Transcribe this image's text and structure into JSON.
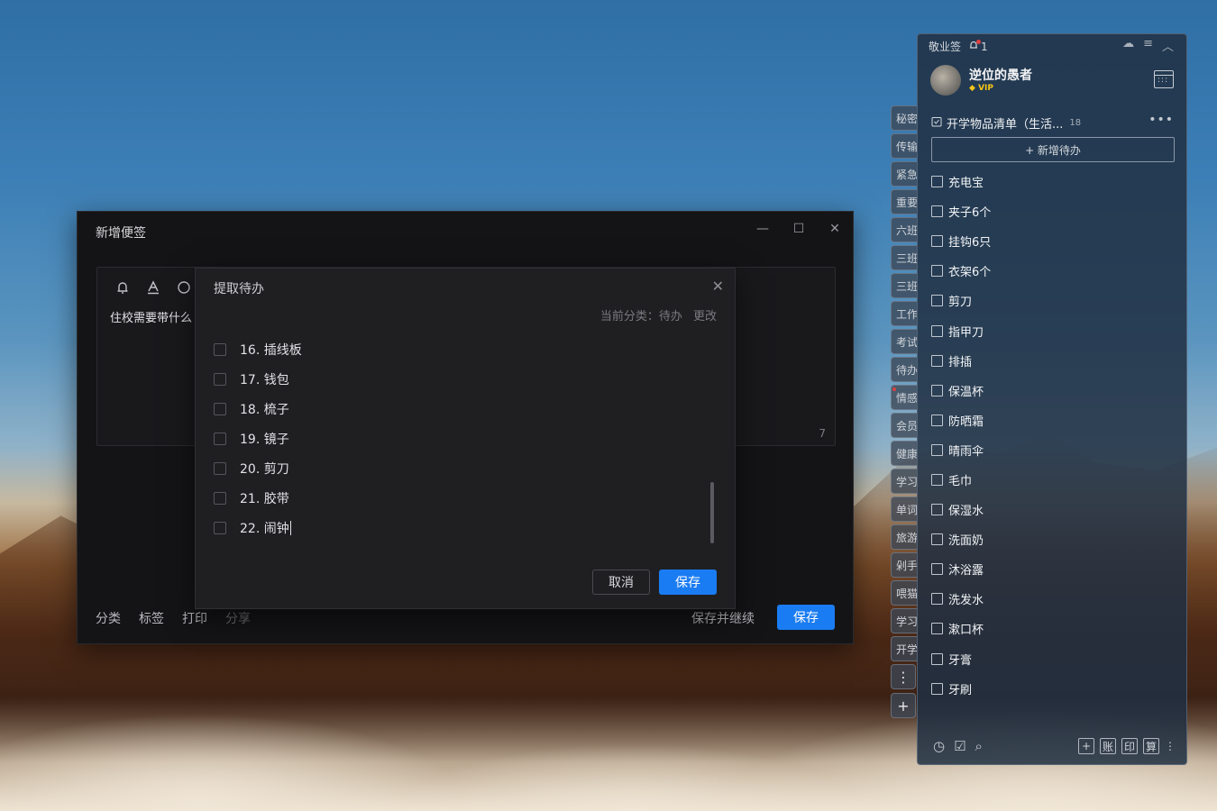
{
  "note_window": {
    "title": "新增便签",
    "controls": {
      "minimize": "—",
      "maximize": "☐",
      "close": "✕"
    },
    "toolbar": {
      "bell": "🔔",
      "font": "A",
      "circle": "◯"
    },
    "editor_text": "住校需要带什么",
    "char_count": "7",
    "bottom_links": [
      "分类",
      "标签",
      "打印",
      "分享"
    ],
    "save_continue": "保存并继续",
    "save": "保存"
  },
  "dialog": {
    "title": "提取待办",
    "close": "✕",
    "category_label": "当前分类：待办",
    "change": "更改",
    "items": [
      "16. 插线板",
      "17. 钱包",
      "18. 梳子",
      "19. 镜子",
      "20. 剪刀",
      "21. 胶带",
      "22. 闹钟"
    ],
    "cancel": "取消",
    "save": "保存"
  },
  "side_tabs": [
    "秘密",
    "传输",
    "紧急",
    "重要",
    "六班",
    "三班",
    "三班",
    "工作",
    "考试",
    "待办",
    "情感",
    "会员",
    "健康",
    "学习",
    "单词",
    "旅游",
    "剁手",
    "喂猫",
    "学习",
    "开学"
  ],
  "side_buttons": {
    "more": "⋮",
    "add": "+"
  },
  "panel": {
    "app_name": "敬业签",
    "notification_count": "1",
    "username": "逆位的愚者",
    "vip": "VIP",
    "list_title": "开学物品清单（生活...",
    "list_count": "18",
    "more": "•••",
    "add_todo": "+ 新增待办",
    "items": [
      "充电宝",
      "夹子6个",
      "挂钩6只",
      "衣架6个",
      "剪刀",
      "指甲刀",
      "排插",
      "保温杯",
      "防晒霜",
      "晴雨伞",
      "毛巾",
      "保湿水",
      "洗面奶",
      "沐浴露",
      "洗发水",
      "漱口杯",
      "牙膏",
      "牙刷"
    ],
    "bottom_icons": {
      "clock": "◷",
      "check": "☑",
      "search": "⌕"
    },
    "bottom_tools": [
      "+",
      "账",
      "印",
      "算"
    ]
  }
}
